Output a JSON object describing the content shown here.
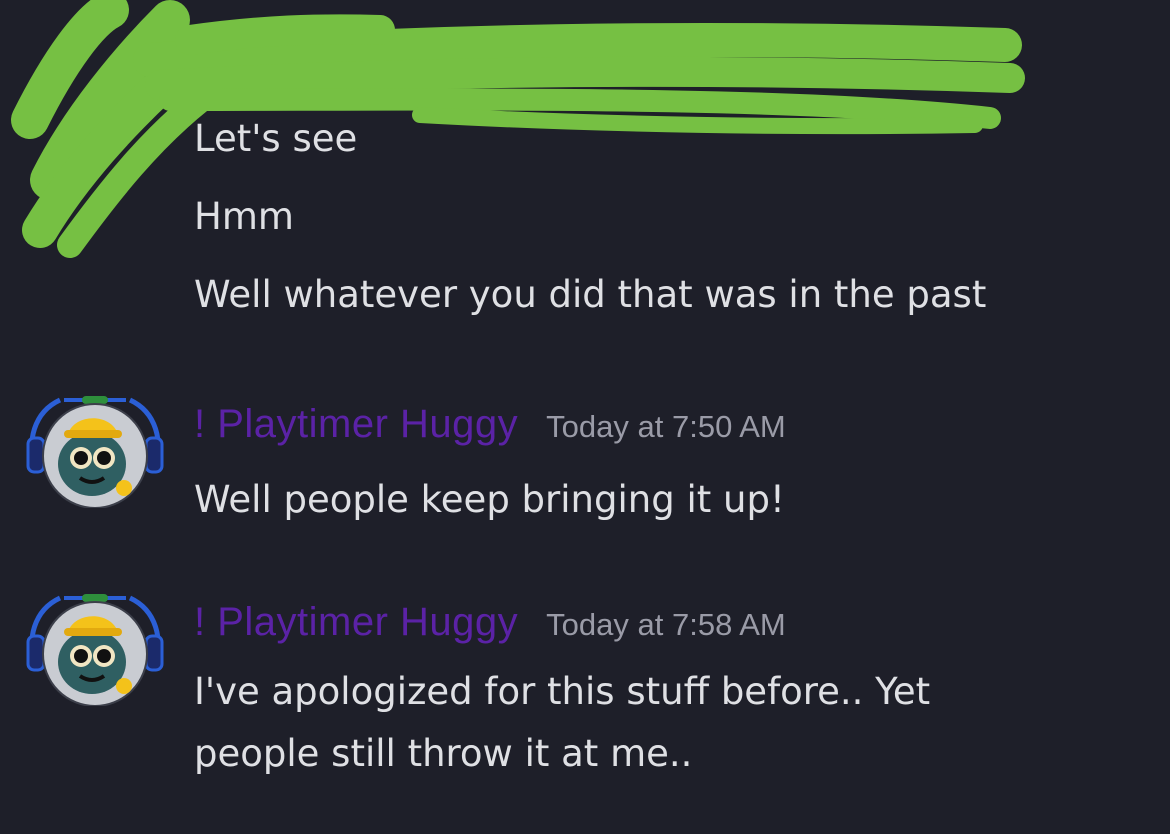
{
  "messages_top": [
    {
      "text": "Let's see"
    },
    {
      "text": "Hmm"
    },
    {
      "text": "Well whatever you did that was in the past"
    }
  ],
  "groups": [
    {
      "username": "! Playtimer Huggy",
      "timestamp": "Today at 7:50 AM",
      "lines": [
        "Well people keep bringing it up!"
      ]
    },
    {
      "username": "! Playtimer Huggy",
      "timestamp": "Today at 7:58 AM",
      "lines": [
        "I've apologized for this stuff before.. Yet",
        "people still throw it at me.."
      ]
    }
  ],
  "colors": {
    "background": "#1e1f29",
    "username": "#5b22a6",
    "timestamp": "#9a9ba7",
    "message_text": "#dfe0e4",
    "redaction": "#76c043"
  }
}
